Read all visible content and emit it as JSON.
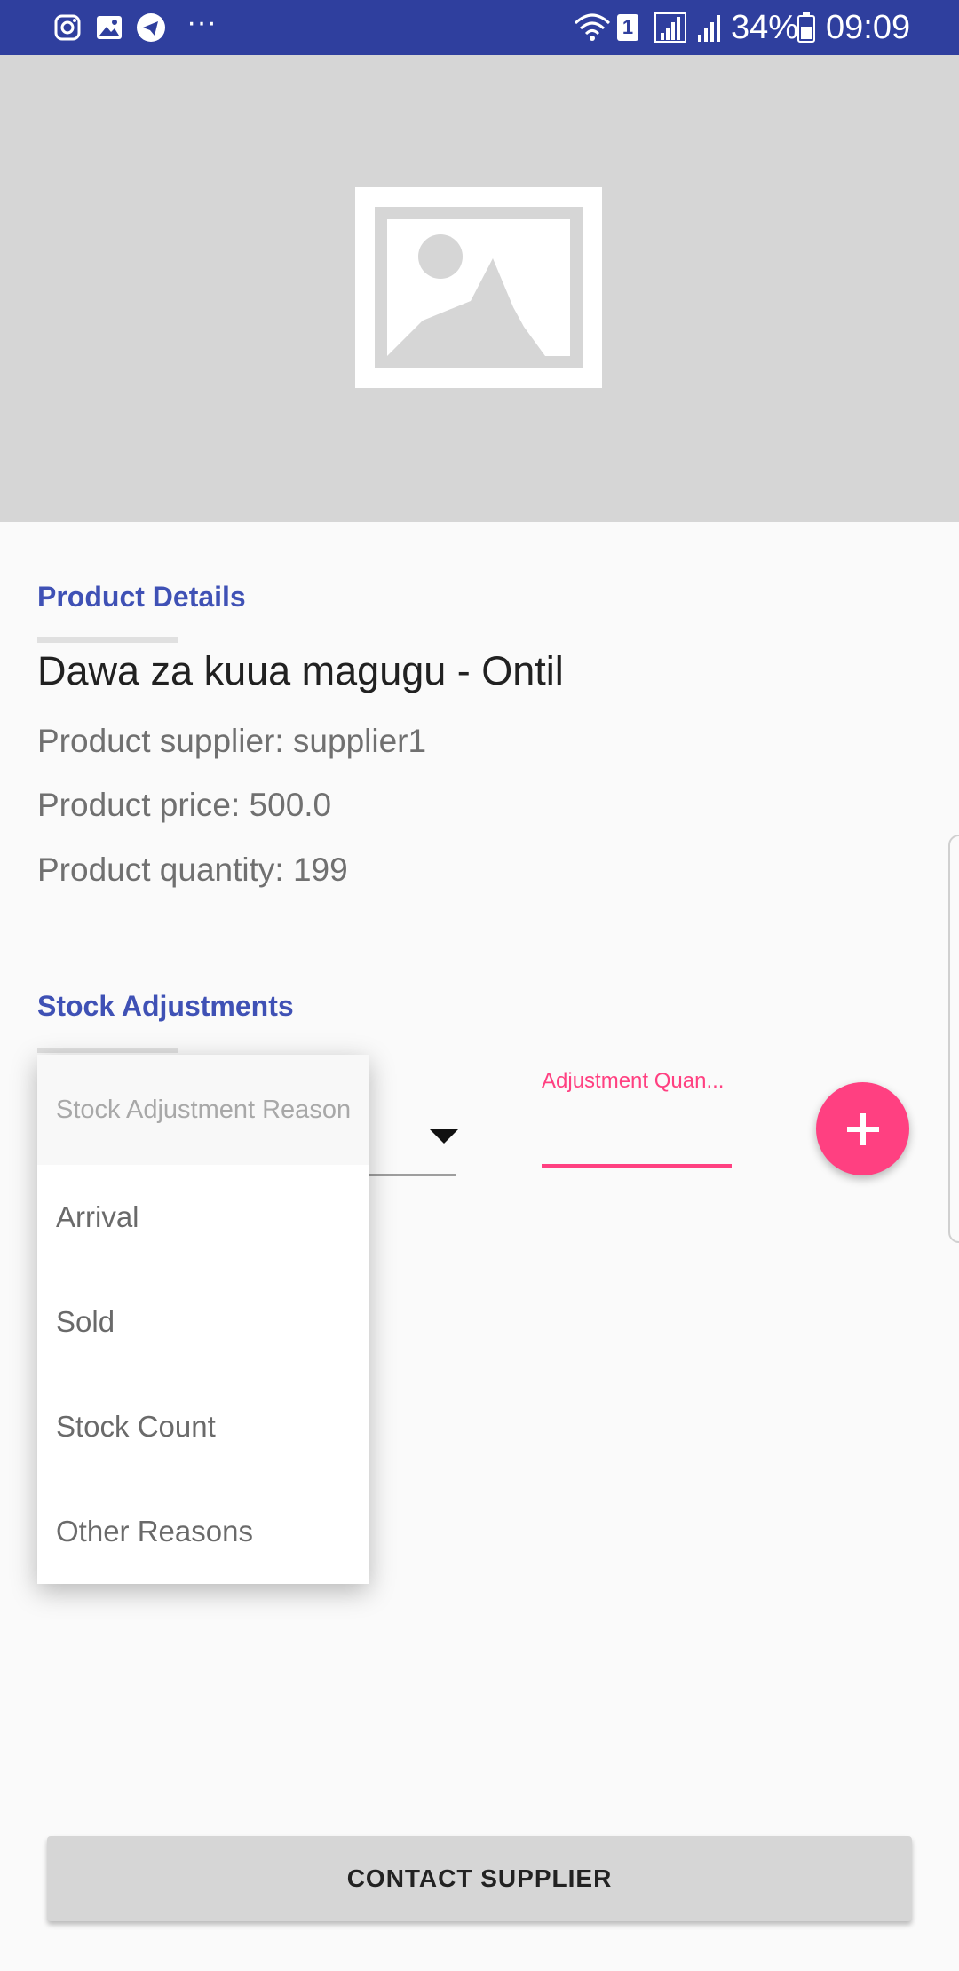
{
  "status_bar": {
    "icons": [
      "instagram-icon",
      "gallery-icon",
      "telegram-icon",
      "more-dots-icon",
      "wifi-icon",
      "sim1-icon",
      "signal-icon",
      "signal-icon",
      "battery-icon"
    ],
    "more": "···",
    "sim": "1",
    "battery": "34%",
    "time": "09:09"
  },
  "hero": {
    "placeholder_icon": "image-placeholder-icon"
  },
  "details": {
    "section_title": "Product Details",
    "product_name": "Dawa za kuua magugu - Ontil",
    "supplier": "Product supplier: supplier1",
    "price": "Product price: 500.0",
    "quantity": "Product quantity: 199"
  },
  "stock": {
    "section_title": "Stock Adjustments",
    "reason_dropdown": {
      "placeholder": "Stock Adjustment Reason",
      "options": [
        "Arrival",
        "Sold",
        "Stock Count",
        "Other Reasons"
      ]
    },
    "quantity_label": "Adjustment Quan...",
    "add_icon": "plus-icon"
  },
  "actions": {
    "contact_supplier": "CONTACT SUPPLIER"
  },
  "colors": {
    "primary": "#3f51b5",
    "status_bar": "#2f3f9e",
    "accent": "#ff4081"
  }
}
